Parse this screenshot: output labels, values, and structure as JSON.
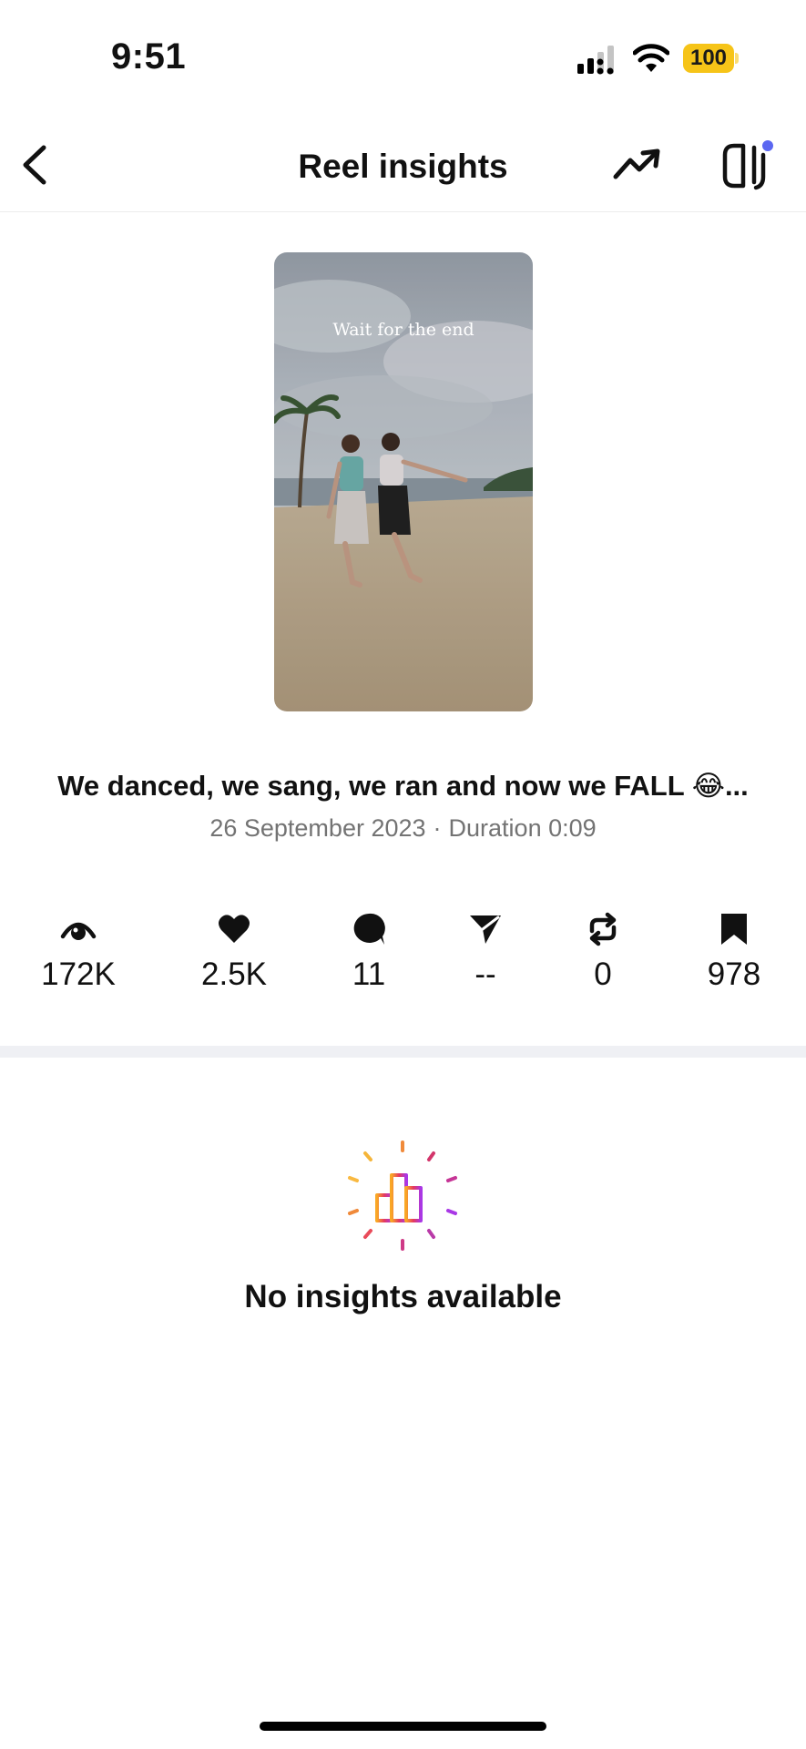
{
  "status_bar": {
    "time": "9:51",
    "battery": "100",
    "battery_color": "#f6c418",
    "icons": [
      "signal-icon",
      "wifi-icon",
      "battery-icon"
    ]
  },
  "header": {
    "title": "Reel insights",
    "icons": [
      "back-chevron-icon",
      "trending-up-icon",
      "side-panel-icon"
    ],
    "badge_color": "#5b67f1"
  },
  "reel": {
    "thumbnail_overlay_text": "Wait for the end",
    "caption": "We danced, we sang, we ran and now we FALL 😂...",
    "date": "26 September 2023",
    "separator": "·",
    "duration": "Duration 0:09"
  },
  "stats": [
    {
      "icon": "eye-icon",
      "value": "172K"
    },
    {
      "icon": "heart-icon",
      "value": "2.5K"
    },
    {
      "icon": "comment-icon",
      "value": "11"
    },
    {
      "icon": "send-icon",
      "value": "--"
    },
    {
      "icon": "repost-icon",
      "value": "0"
    },
    {
      "icon": "bookmark-icon",
      "value": "978"
    }
  ],
  "empty_state": {
    "icon": "bar-chart-sparkle-icon",
    "message": "No insights available",
    "gradient": [
      "#f9a825",
      "#e53960",
      "#a938e6"
    ]
  }
}
